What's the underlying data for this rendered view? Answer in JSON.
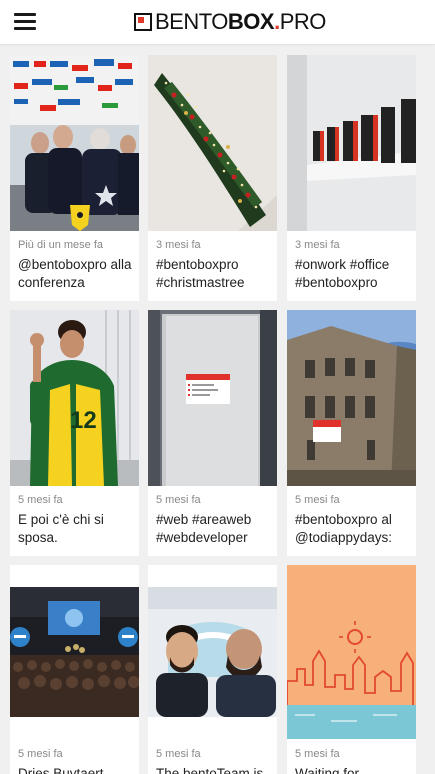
{
  "header": {
    "menu_icon": "hamburger-menu-icon",
    "logo": {
      "part1": "BENTO",
      "part2": "BOX",
      "dot": ".",
      "part3": "PRO"
    }
  },
  "posts": [
    {
      "time": "Più di un mese fa",
      "caption": "@bentoboxpro alla conferenza"
    },
    {
      "time": "3 mesi fa",
      "caption": "#bentoboxpro #christmastree"
    },
    {
      "time": "3 mesi fa",
      "caption": "#onwork #office #bentoboxpro"
    },
    {
      "time": "5 mesi fa",
      "caption": "E poi c'è chi si sposa."
    },
    {
      "time": "5 mesi fa",
      "caption": "#web #areaweb #webdeveloper"
    },
    {
      "time": "5 mesi fa",
      "caption": "#bentoboxpro al @todiappydays:"
    },
    {
      "time": "5 mesi fa",
      "caption": "Dries Buytaert"
    },
    {
      "time": "5 mesi fa",
      "caption": "The bentoTeam is"
    },
    {
      "time": "5 mesi fa",
      "caption": "Waiting for"
    }
  ],
  "colors": {
    "brand_red": "#e03a2a",
    "page_bg": "#f0f0f0"
  }
}
